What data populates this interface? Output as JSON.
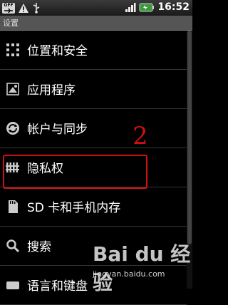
{
  "status_bar": {
    "icons": [
      "airplane-off-icon",
      "warning-icon",
      "usb-icon",
      "signal-icon",
      "battery-icon"
    ],
    "off_label": "OFF",
    "time": "16:52"
  },
  "title_bar": {
    "title": "设置"
  },
  "menu_items": [
    {
      "label": "位置和安全",
      "icon": "location-security-icon"
    },
    {
      "label": "应用程序",
      "icon": "applications-icon"
    },
    {
      "label": "帐户与同步",
      "icon": "sync-icon"
    },
    {
      "label": "隐私权",
      "icon": "privacy-icon"
    },
    {
      "label": "SD 卡和手机内存",
      "icon": "sd-card-icon"
    },
    {
      "label": "搜索",
      "icon": "search-icon"
    },
    {
      "label": "语言和键盘",
      "icon": "keyboard-icon"
    }
  ],
  "annotation": {
    "number": "2",
    "color": "#d01010"
  },
  "watermark": {
    "brand": "Bai du 经验",
    "url": "jingyan.baidu.com"
  }
}
